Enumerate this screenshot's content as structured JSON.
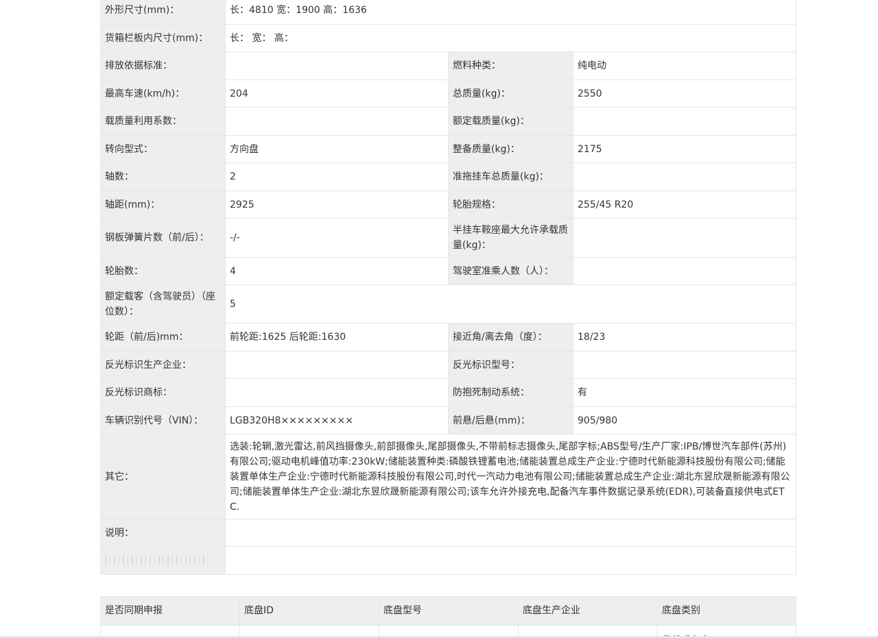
{
  "spec": {
    "dimensions_label": "外形尺寸(mm)：",
    "dimensions_value": "长：4810 宽：1900 高：1636",
    "cargo_box_label": "货箱栏板内尺寸(mm)：",
    "cargo_box_value": "长： 宽： 高：",
    "emission_label": "排放依据标准：",
    "emission_value": "",
    "fuel_label": "燃料种类：",
    "fuel_value": "纯电动",
    "max_speed_label": "最高车速(km/h)：",
    "max_speed_value": "204",
    "gross_mass_label": "总质量(kg)：",
    "gross_mass_value": "2550",
    "load_factor_label": "载质量利用系数：",
    "load_factor_value": "",
    "rated_load_label": "额定载质量(kg)：",
    "rated_load_value": "",
    "steering_label": "转向型式：",
    "steering_value": "方向盘",
    "curb_mass_label": "整备质量(kg)：",
    "curb_mass_value": "2175",
    "axles_label": "轴数：",
    "axles_value": "2",
    "trailer_mass_label": "准拖挂车总质量(kg)：",
    "trailer_mass_value": "",
    "wheelbase_label": "轴距(mm)：",
    "wheelbase_value": "2925",
    "tire_spec_label": "轮胎规格：",
    "tire_spec_value": "255/45 R20",
    "leaf_spring_label": "钢板弹簧片数（前/后）：",
    "leaf_spring_value": "-/-",
    "saddle_load_label": "半挂车鞍座最大允许承载质量(kg)：",
    "saddle_load_value": "",
    "tire_count_label": "轮胎数：",
    "tire_count_value": "4",
    "cab_passengers_label": "驾驶室准乘人数（人）：",
    "cab_passengers_value": "",
    "rated_passengers_label": "额定载客（含驾驶员）（座位数）：",
    "rated_passengers_value": "5",
    "track_label": "轮距（前/后)mm：",
    "track_value": "前轮距:1625 后轮距:1630",
    "approach_angle_label": "接近角/离去角（度）：",
    "approach_angle_value": "18/23",
    "reflector_maker_label": "反光标识生产企业：",
    "reflector_maker_value": "",
    "reflector_model_label": "反光标识型号：",
    "reflector_model_value": "",
    "reflector_brand_label": "反光标识商标：",
    "reflector_brand_value": "",
    "abs_label": "防抱死制动系统：",
    "abs_value": "有",
    "vin_label": "车辆识别代号（VIN）：",
    "vin_value": "LGB320H8×××××××××",
    "overhang_label": "前悬/后悬(mm)：",
    "overhang_value": "905/980",
    "other_label": "其它：",
    "other_value": "选装:轮辋,激光雷达,前风挡摄像头,前部摄像头,尾部摄像头,不带前标志摄像头,尾部字标;ABS型号/生产厂家:IPB/博世汽车部件(苏州)有限公司;驱动电机峰值功率:230kW;储能装置种类:磷酸铁锂蓄电池;储能装置总成生产企业:宁德时代新能源科技股份有限公司;储能装置单体生产企业:宁德时代新能源科技股份有限公司,时代一汽动力电池有限公司;储能装置总成生产企业:湖北东昱欣晟新能源有限公司;储能装置单体生产企业:湖北东昱欣晟新能源有限公司;该车允许外接充电,配备汽车事件数据记录系统(EDR),可装备直接供电式ETC.",
    "note_label": "说明：",
    "note_value": ""
  },
  "chassis": {
    "headers": [
      "是否同期申报",
      "底盘ID",
      "底盘型号",
      "底盘生产企业",
      "底盘类别"
    ],
    "row": [
      "",
      "",
      "",
      "",
      "承载式车身"
    ]
  },
  "icons": {
    "redacted": "blurred-text-mark"
  }
}
